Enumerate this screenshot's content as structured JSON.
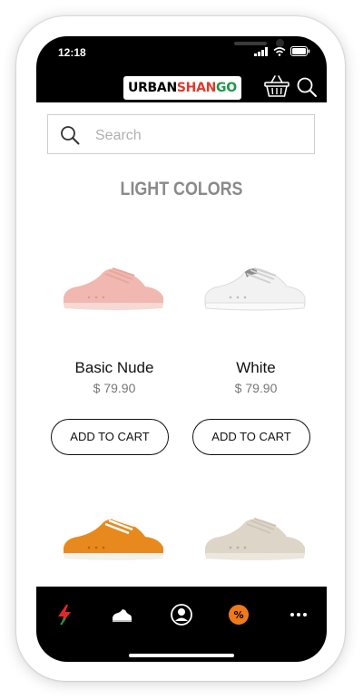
{
  "status_bar": {
    "time": "12:18"
  },
  "header": {
    "logo_part1": "URBAN",
    "logo_part2": "SHAN",
    "logo_part3": "GO",
    "cart_icon": "basket-icon",
    "search_icon": "search-icon"
  },
  "search": {
    "placeholder": "Search",
    "value": ""
  },
  "section": {
    "title": "LIGHT COLORS"
  },
  "products": [
    {
      "name": "Basic Nude",
      "price": "$ 79.90",
      "button": "ADD TO CART",
      "color": "#f0b8b0"
    },
    {
      "name": "White",
      "price": "$ 79.90",
      "button": "ADD TO CART",
      "color": "#f2f2f2"
    },
    {
      "color": "#e8891e"
    },
    {
      "color": "#ddd6c8"
    }
  ],
  "bottom_nav": [
    {
      "icon": "lightning-icon",
      "accent": "#e0282a"
    },
    {
      "icon": "sneaker-icon"
    },
    {
      "icon": "profile-icon"
    },
    {
      "icon": "discount-badge-icon",
      "accent": "#f07a1a"
    },
    {
      "icon": "more-icon"
    }
  ]
}
